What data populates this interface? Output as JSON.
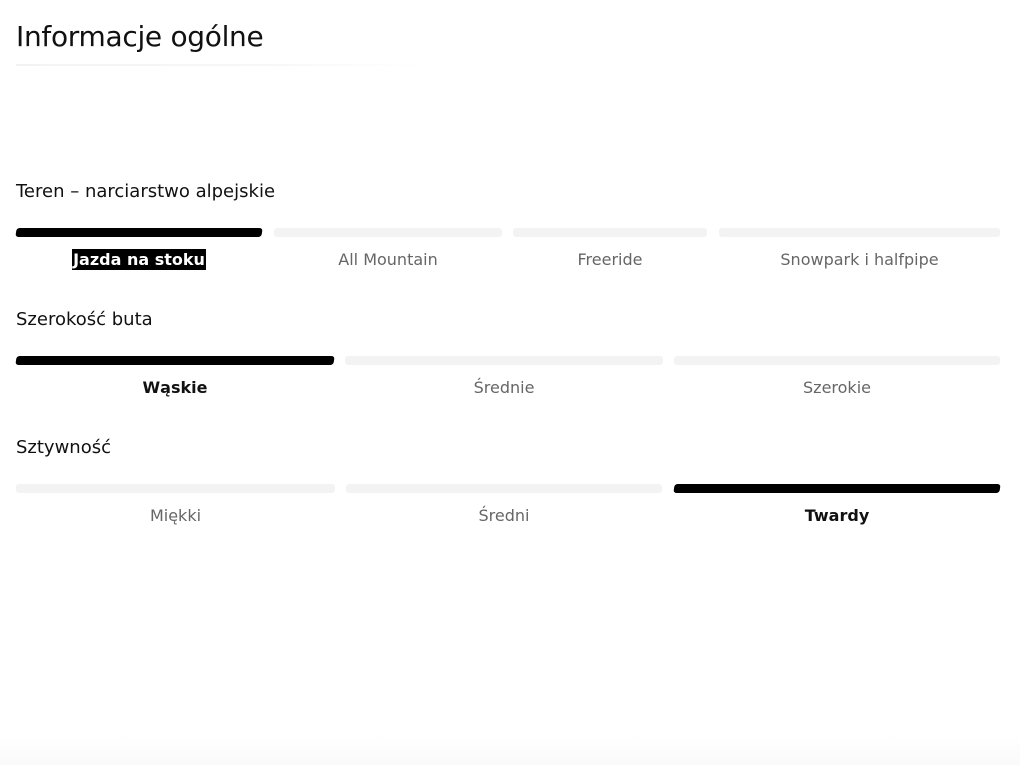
{
  "page": {
    "title": "Informacje ogólne"
  },
  "terrain": {
    "title": "Teren – narciarstwo alpejskie",
    "options": [
      {
        "label": "Jazda na stoku",
        "selected": true
      },
      {
        "label": "All Mountain",
        "selected": false
      },
      {
        "label": "Freeride",
        "selected": false
      },
      {
        "label": "Snowpark i halfpipe",
        "selected": false
      }
    ]
  },
  "width": {
    "title": "Szerokość buta",
    "options": [
      {
        "label": "Wąskie",
        "selected": true
      },
      {
        "label": "Średnie",
        "selected": false
      },
      {
        "label": "Szerokie",
        "selected": false
      }
    ]
  },
  "stiffness": {
    "title": "Sztywność",
    "options": [
      {
        "label": "Miękki",
        "selected": false
      },
      {
        "label": "Średni",
        "selected": false
      },
      {
        "label": "Twardy",
        "selected": true
      }
    ]
  },
  "colors": {
    "active_bar": "#000000",
    "inactive_bar": "#f3f3f3",
    "inactive_text": "#666666"
  }
}
